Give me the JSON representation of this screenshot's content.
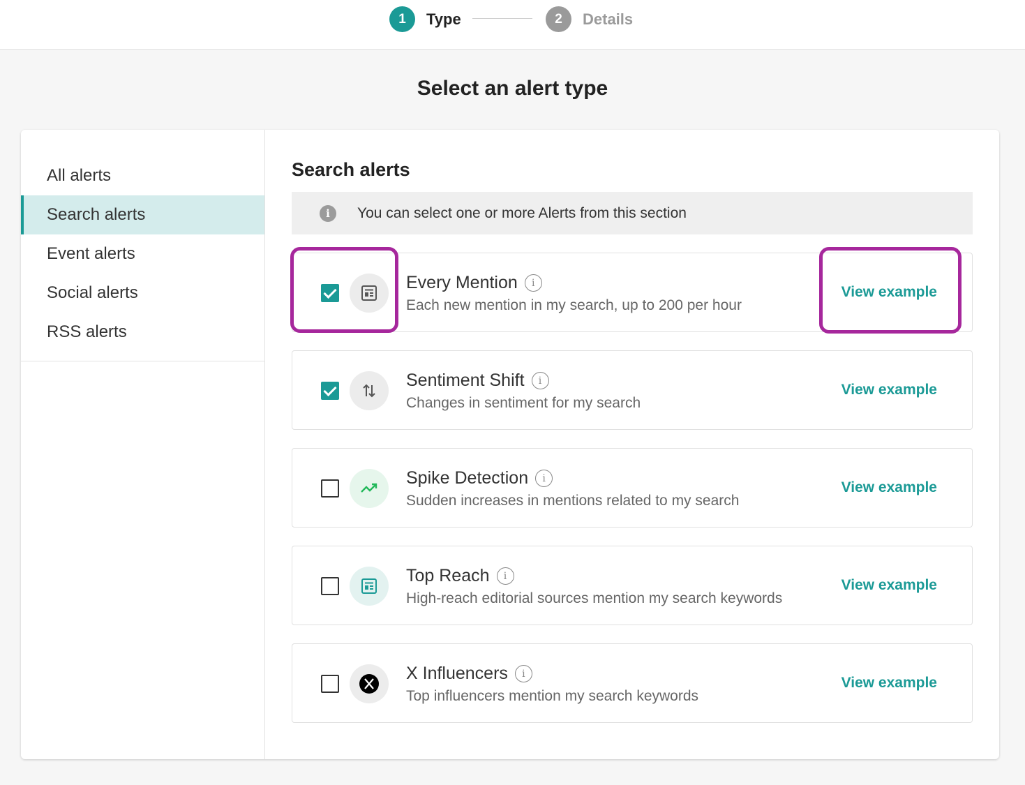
{
  "stepper": {
    "steps": [
      {
        "number": "1",
        "label": "Type",
        "state": "active"
      },
      {
        "number": "2",
        "label": "Details",
        "state": "inactive"
      }
    ]
  },
  "page": {
    "title": "Select an alert type"
  },
  "sidebar": {
    "items": [
      {
        "label": "All alerts"
      },
      {
        "label": "Search alerts",
        "active": true
      },
      {
        "label": "Event alerts"
      },
      {
        "label": "Social alerts"
      },
      {
        "label": "RSS alerts"
      }
    ]
  },
  "main": {
    "section_title": "Search alerts",
    "info_text": "You can select one or more Alerts from this section",
    "alerts": [
      {
        "title": "Every Mention",
        "description": "Each new mention in my search, up to 200 per hour",
        "checked": true,
        "icon": "document-icon",
        "link": "View example"
      },
      {
        "title": "Sentiment Shift",
        "description": "Changes in sentiment for my search",
        "checked": true,
        "icon": "sort-arrows-icon",
        "link": "View example"
      },
      {
        "title": "Spike Detection",
        "description": "Sudden increases in mentions related to my search",
        "checked": false,
        "icon": "trending-up-icon",
        "link": "View example"
      },
      {
        "title": "Top Reach",
        "description": "High-reach editorial sources mention my search keywords",
        "checked": false,
        "icon": "document-icon",
        "link": "View example"
      },
      {
        "title": "X Influencers",
        "description": "Top influencers mention my search keywords",
        "checked": false,
        "icon": "x-logo-icon",
        "link": "View example"
      }
    ]
  },
  "colors": {
    "accent": "#1b9a96",
    "highlight": "#a6279c",
    "step_inactive": "#9a9a9a"
  }
}
